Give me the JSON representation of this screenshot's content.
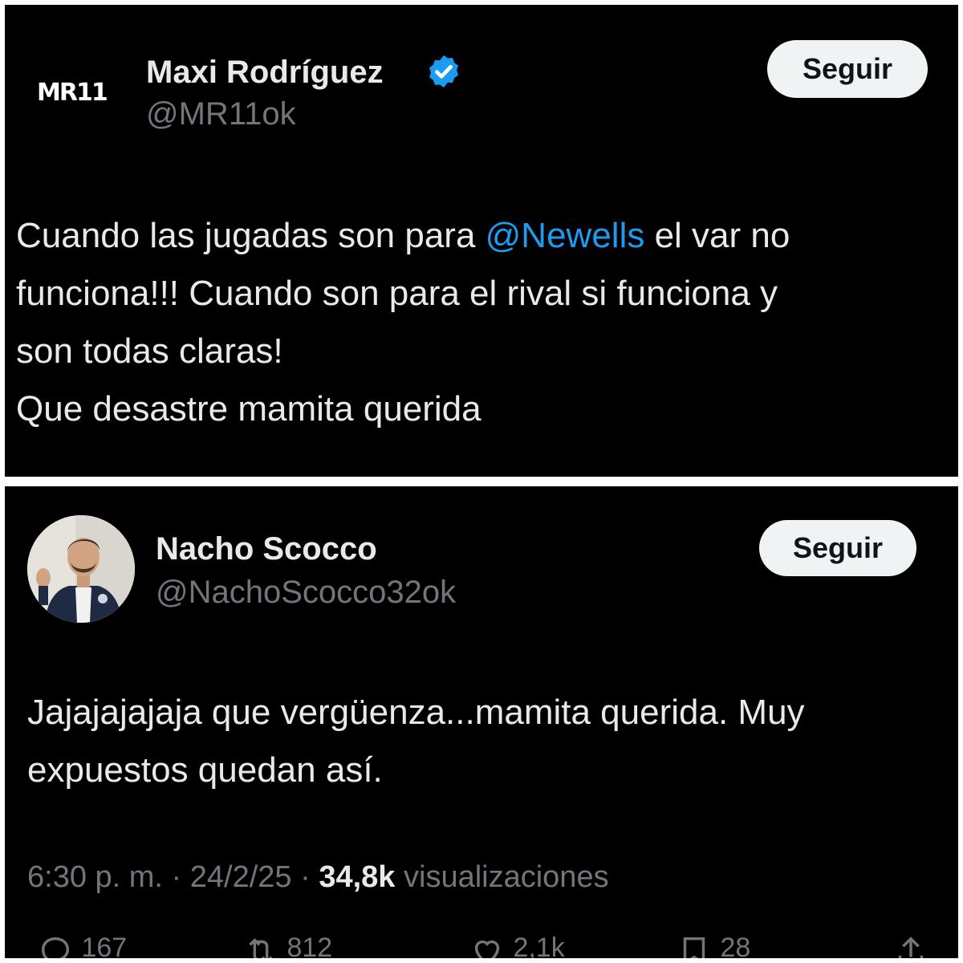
{
  "tweets": [
    {
      "logo_text": "MR11",
      "name": "Maxi Rodríguez",
      "verified": true,
      "handle": "@MR11ok",
      "follow_label": "Seguir",
      "text_lines": [
        {
          "before": "Cuando las jugadas son para ",
          "mention": "@Newells",
          "after": " el var no"
        },
        {
          "text": "funciona!!! Cuando son para el rival si funciona y"
        },
        {
          "text": "son todas claras!"
        },
        {
          "text": "Que desastre mamita querida"
        }
      ]
    },
    {
      "name": "Nacho Scocco",
      "handle": "@NachoScocco32ok",
      "follow_label": "Seguir",
      "text_lines": [
        {
          "text": "Jajajajajaja que vergüenza...mamita querida. Muy"
        },
        {
          "text": "expuestos quedan así."
        }
      ],
      "meta": {
        "time": "6:30 p. m.",
        "separator": "·",
        "date": "24/2/25",
        "views_count": "34,8k",
        "views_label": "visualizaciones"
      },
      "actions": {
        "replies": "167",
        "reposts": "812",
        "likes": "2,1k",
        "bookmarks": "28"
      }
    }
  ],
  "colors": {
    "background": "#000000",
    "text": "#e7e9ea",
    "secondary": "#71767b",
    "accent": "#1d9bf0",
    "button_bg": "#eff3f4"
  },
  "icons": [
    "verified-badge-icon",
    "reply-icon",
    "repost-icon",
    "like-icon",
    "bookmark-icon",
    "share-icon"
  ]
}
